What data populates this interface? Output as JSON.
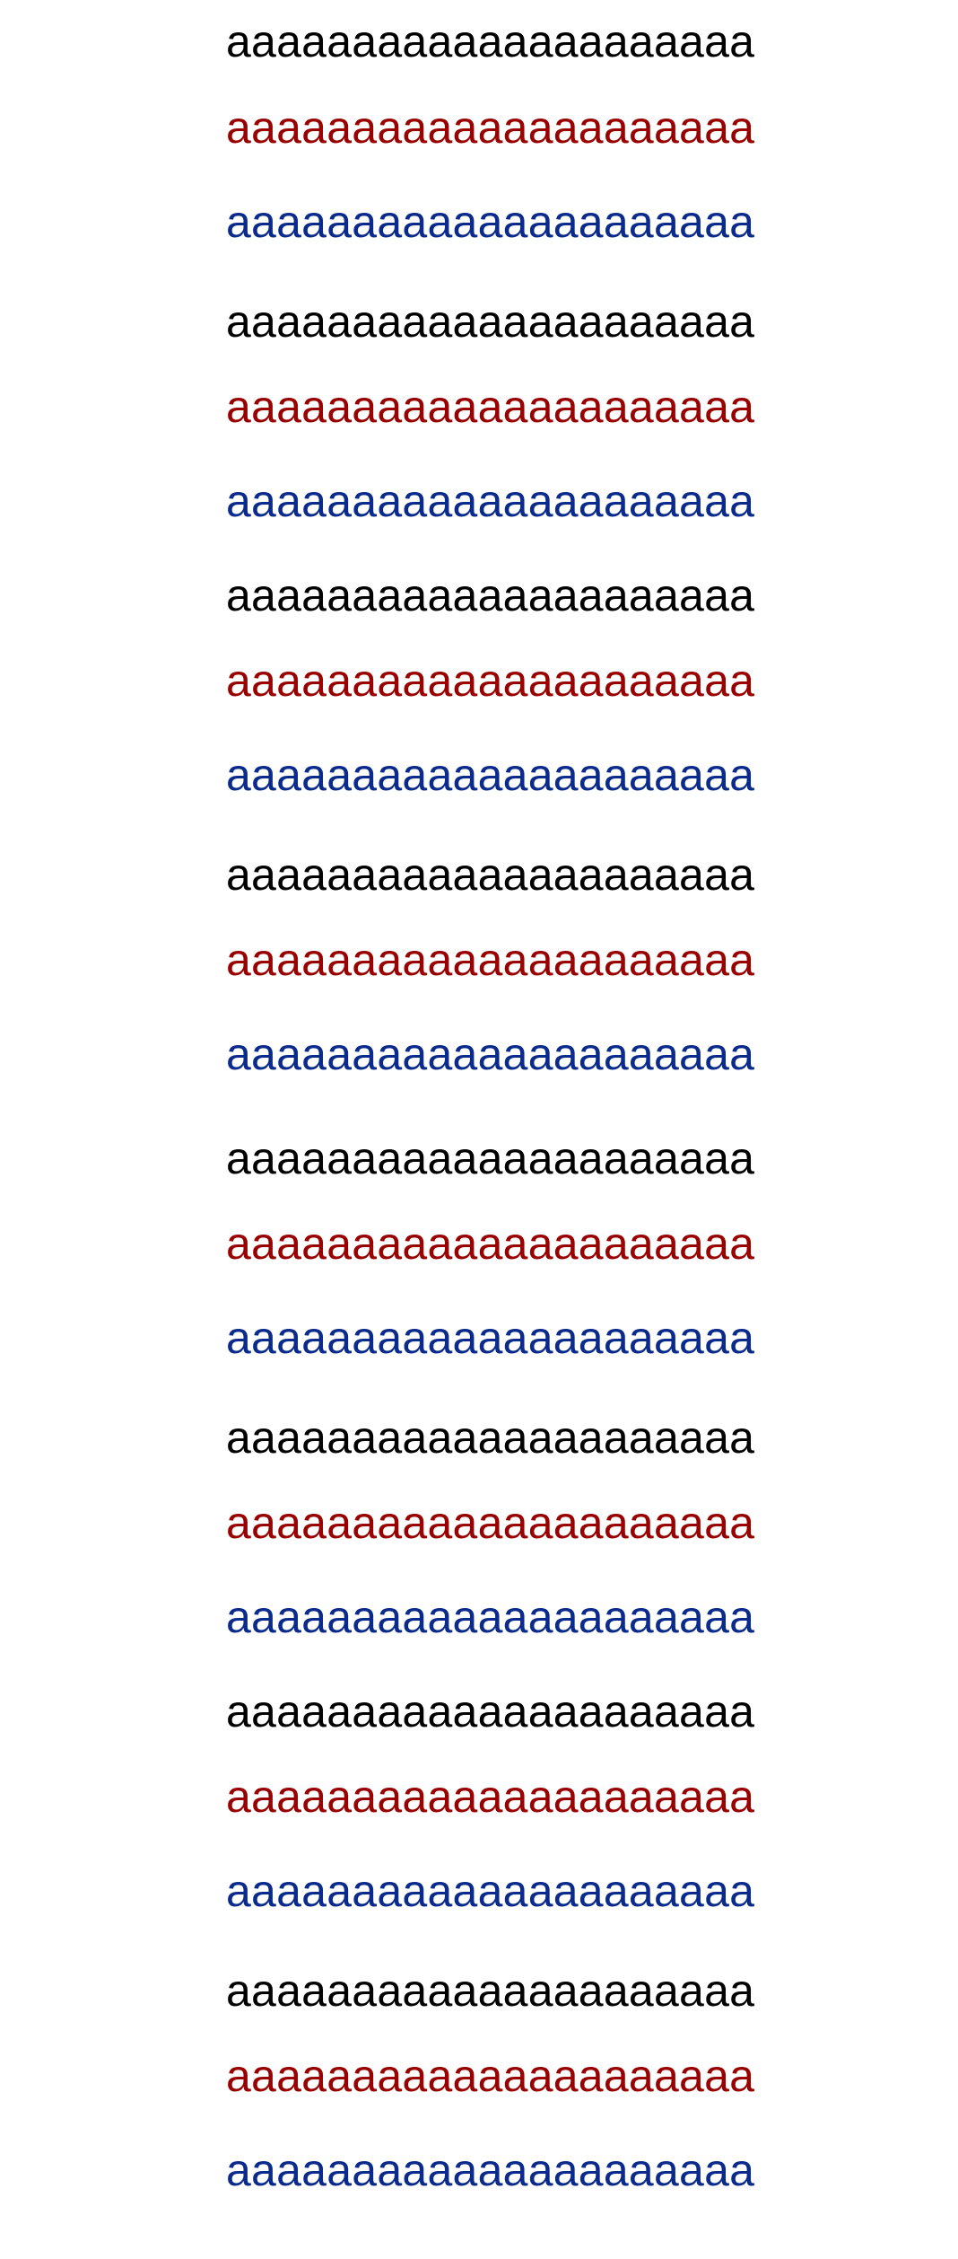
{
  "text_lines": [
    {
      "text": "aaaaaaaaaaaaaaaaaaaaa",
      "color": "#000000"
    },
    {
      "text": "aaaaaaaaaaaaaaaaaaaaa",
      "color": "#990000"
    },
    {
      "text": "aaaaaaaaaaaaaaaaaaaaa",
      "color": "#0a2a8c"
    },
    {
      "text": "aaaaaaaaaaaaaaaaaaaaa",
      "color": "#000000"
    },
    {
      "text": "aaaaaaaaaaaaaaaaaaaaa",
      "color": "#990000"
    },
    {
      "text": "aaaaaaaaaaaaaaaaaaaaa",
      "color": "#0a2a8c"
    },
    {
      "text": "aaaaaaaaaaaaaaaaaaaaa",
      "color": "#000000"
    },
    {
      "text": "aaaaaaaaaaaaaaaaaaaaa",
      "color": "#990000"
    },
    {
      "text": "aaaaaaaaaaaaaaaaaaaaa",
      "color": "#0a2a8c"
    },
    {
      "text": "aaaaaaaaaaaaaaaaaaaaa",
      "color": "#000000"
    },
    {
      "text": "aaaaaaaaaaaaaaaaaaaaa",
      "color": "#990000"
    },
    {
      "text": "aaaaaaaaaaaaaaaaaaaaa",
      "color": "#0a2a8c"
    },
    {
      "text": "aaaaaaaaaaaaaaaaaaaaa",
      "color": "#000000"
    },
    {
      "text": "aaaaaaaaaaaaaaaaaaaaa",
      "color": "#990000"
    },
    {
      "text": "aaaaaaaaaaaaaaaaaaaaa",
      "color": "#0a2a8c"
    },
    {
      "text": "aaaaaaaaaaaaaaaaaaaaa",
      "color": "#000000"
    },
    {
      "text": "aaaaaaaaaaaaaaaaaaaaa",
      "color": "#990000"
    },
    {
      "text": "aaaaaaaaaaaaaaaaaaaaa",
      "color": "#0a2a8c"
    },
    {
      "text": "aaaaaaaaaaaaaaaaaaaaa",
      "color": "#000000"
    },
    {
      "text": "aaaaaaaaaaaaaaaaaaaaa",
      "color": "#990000"
    },
    {
      "text": "aaaaaaaaaaaaaaaaaaaaa",
      "color": "#0a2a8c"
    },
    {
      "text": "aaaaaaaaaaaaaaaaaaaaa",
      "color": "#000000"
    },
    {
      "text": "aaaaaaaaaaaaaaaaaaaaa",
      "color": "#990000"
    },
    {
      "text": "aaaaaaaaaaaaaaaaaaaaa",
      "color": "#0a2a8c"
    }
  ]
}
